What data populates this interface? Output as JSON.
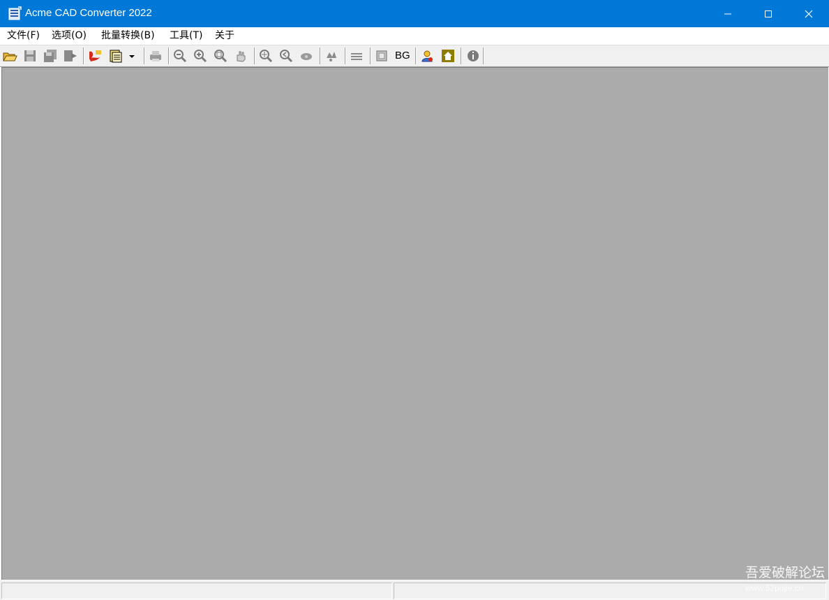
{
  "window": {
    "title": "Acme CAD Converter 2022"
  },
  "menu": {
    "items": [
      "文件(F)",
      "选项(O)",
      "批量转换(B)",
      "工具(T)",
      "关于"
    ]
  },
  "toolbar": {
    "bg_label": "BG",
    "icons": [
      "open-folder-icon",
      "save-icon",
      "save-as-icon",
      "export-icon",
      "cad-to-pdf-icon",
      "batch-convert-icon",
      "dropdown-arrow-icon",
      "print-icon",
      "zoom-out-icon",
      "zoom-in-icon",
      "zoom-window-icon",
      "pan-icon",
      "zoom-extents-icon",
      "zoom-previous-icon",
      "view-icon",
      "layers-icon",
      "layer-list-icon",
      "background-icon",
      "user-help-icon",
      "home-icon",
      "about-info-icon"
    ]
  },
  "status": {
    "pane1": "",
    "pane2": ""
  },
  "watermark": {
    "line1": "吾爱破解论坛",
    "line2": "www.52pojie.cn"
  },
  "colors": {
    "titlebar": "#0078d7",
    "workspace": "#ababab",
    "toolbar": "#f0f0f0"
  }
}
